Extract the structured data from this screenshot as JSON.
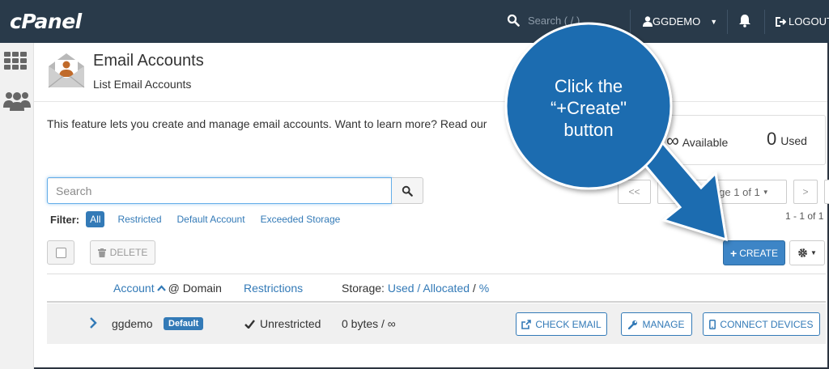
{
  "topbar": {
    "logo": "cPanel",
    "search_placeholder": "Search ( / )",
    "username": "GGDEMO",
    "logout_label": "LOGOUT"
  },
  "page": {
    "title": "Email Accounts",
    "subtitle": "List Email Accounts",
    "feature_text": "This feature lets you create and manage email accounts. Want to learn more? Read our",
    "stats": {
      "available_value": "∞",
      "available_label": "Available",
      "used_value": "0",
      "used_label": "Used"
    }
  },
  "search": {
    "placeholder": "Search"
  },
  "pagination": {
    "first": "<<",
    "prev": "<",
    "page_of": "Page 1 of 1",
    "next": ">",
    "last": ">>",
    "count": "1 - 1 of 1"
  },
  "filters": {
    "label": "Filter:",
    "all": "All",
    "items": [
      "Restricted",
      "Default Account",
      "Exceeded Storage"
    ]
  },
  "actions": {
    "delete": "DELETE",
    "create": "CREATE"
  },
  "columns": {
    "account": "Account",
    "at_domain": "@ Domain",
    "restrictions": "Restrictions",
    "storage_label": "Storage:",
    "used": "Used",
    "allocated": "Allocated",
    "percent": "%",
    "sep": "/"
  },
  "rows": [
    {
      "account": "ggdemo",
      "badge": "Default",
      "restriction": "Unrestricted",
      "storage": "0 bytes / ∞",
      "check_email": "CHECK EMAIL",
      "manage": "MANAGE",
      "connect": "CONNECT DEVICES"
    }
  ],
  "callout": {
    "line1": "Click the",
    "line2": "“+Create\"",
    "line3": "button",
    "color": "#1f6cb0"
  },
  "colors": {
    "topbar": "#293a4a",
    "primary": "#337ab7"
  }
}
